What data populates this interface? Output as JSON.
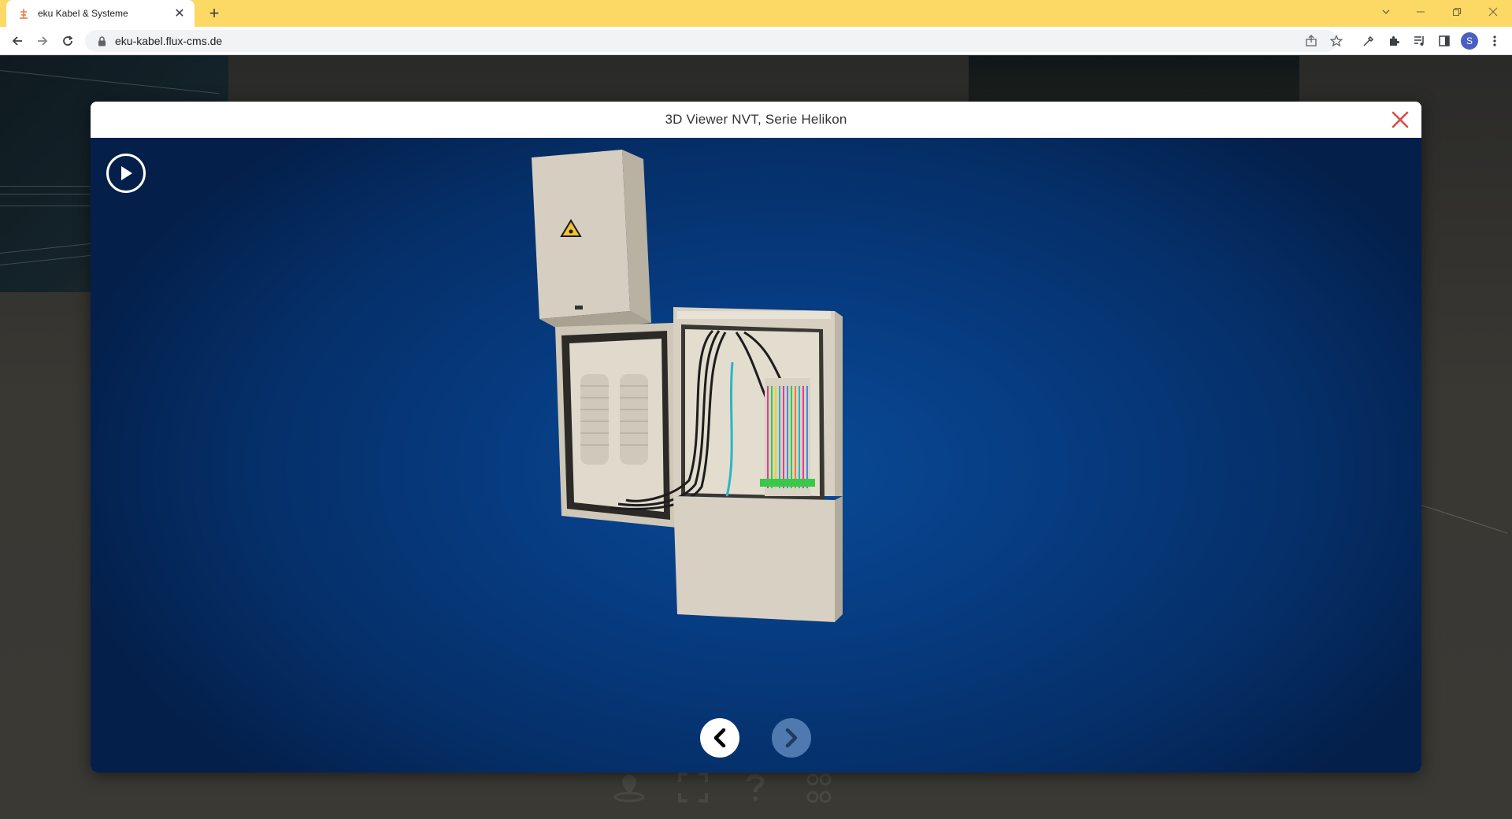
{
  "browser": {
    "tab_title": "eku Kabel & Systeme",
    "url": "eku-kabel.flux-cms.de",
    "profile_initial": "S"
  },
  "modal": {
    "title": "3D Viewer NVT, Serie Helikon"
  },
  "colors": {
    "tabbar": "#fcd864",
    "viewer_background": "#063b80",
    "close_icon": "#e04a4a",
    "next_button": "#4f7ab0",
    "cabinet": "#d8d0c2"
  },
  "icons": {
    "play": "play-icon",
    "prev": "chevron-left-icon",
    "next": "chevron-right-icon",
    "close": "close-icon"
  }
}
